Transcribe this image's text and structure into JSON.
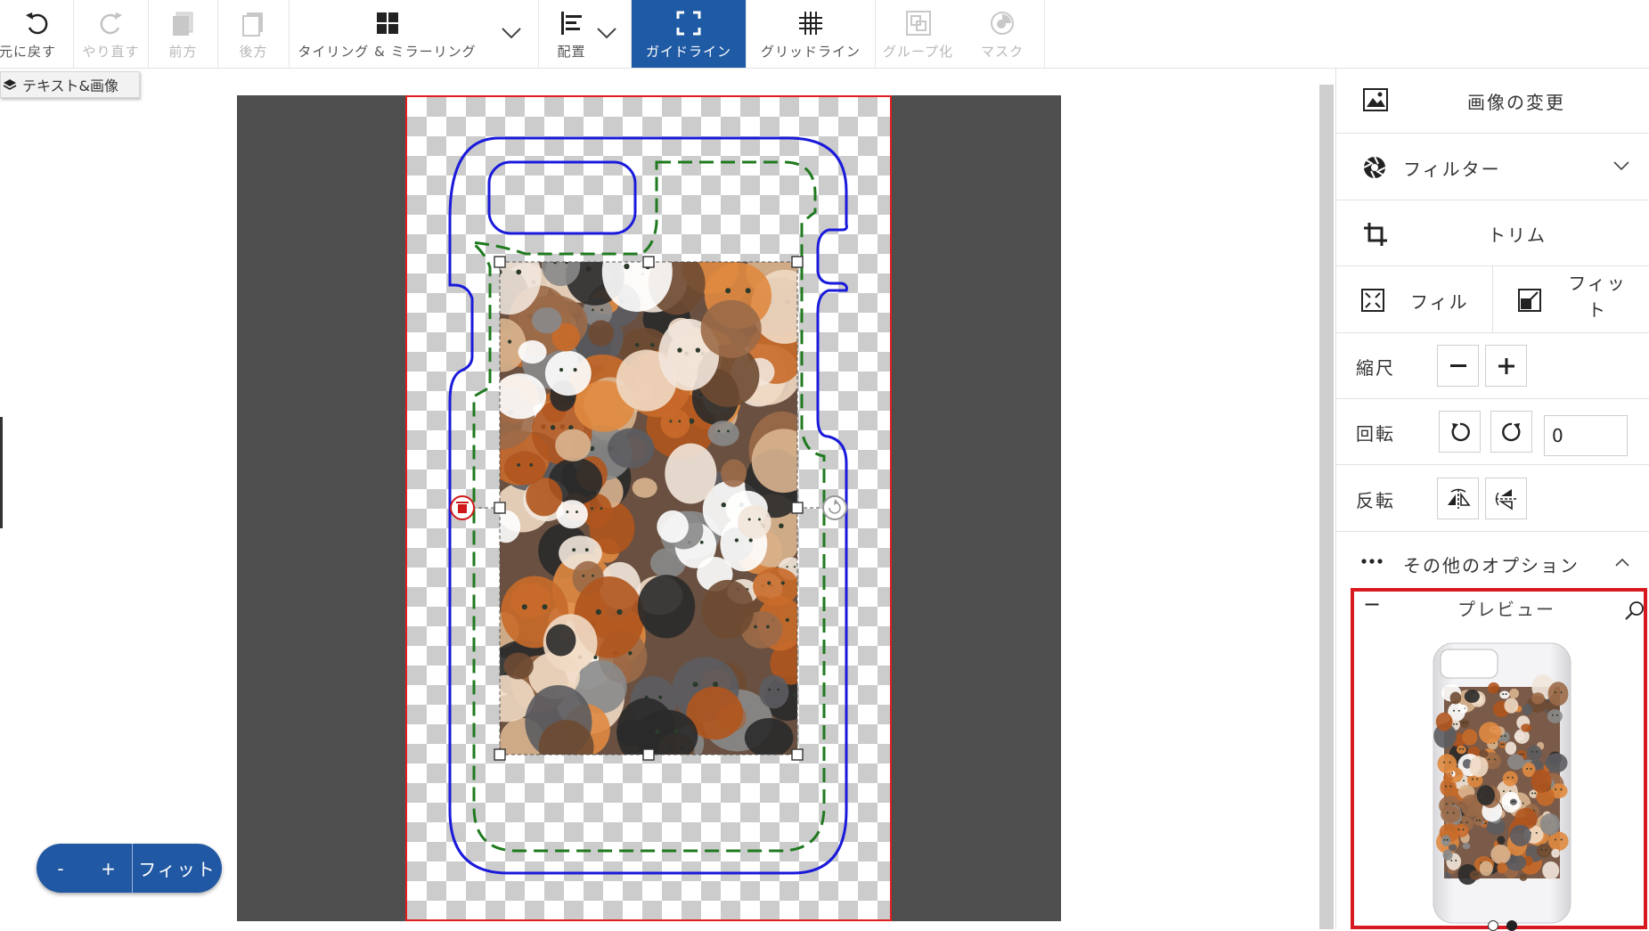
{
  "toolbar": {
    "undo": "元に戻す",
    "redo": "やり直す",
    "forward": "前方",
    "backward": "後方",
    "tiling": "タイリング & ミラーリング",
    "arrange": "配置",
    "guidelines": "ガイドライン",
    "gridlines": "グリッドライン",
    "group": "グループ化",
    "mask": "マスク"
  },
  "layer_tooltip": "テキスト&画像",
  "zoom": {
    "minus": "-",
    "plus": "+",
    "fit": "フィット"
  },
  "panel": {
    "change_image": "画像の変更",
    "filter": "フィルター",
    "trim": "トリム",
    "fill": "フィル",
    "fit": "フィット",
    "scale": "縮尺",
    "rotate": "回転",
    "rotate_value": "0",
    "flip": "反転",
    "more_options": "その他のオプション",
    "preview": "プレビュー",
    "preview_collapse": "−"
  },
  "colors": {
    "accent": "#1f5ba4",
    "canvas_bg": "#4e4e4e",
    "artboard_border": "#e21d1d",
    "cut_line": "#1a1adb",
    "safe_line": "#1f7a1f",
    "preview_border": "#d71920"
  },
  "preview_dots": {
    "count": 2,
    "active": 2
  }
}
